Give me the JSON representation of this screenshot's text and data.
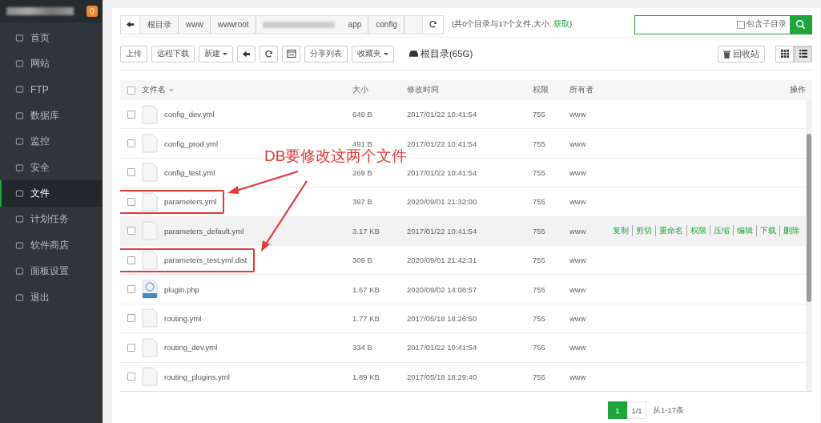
{
  "sidebar": {
    "badge": "0",
    "items": [
      {
        "label": "首页",
        "selected": false
      },
      {
        "label": "网站",
        "selected": false
      },
      {
        "label": "FTP",
        "selected": false
      },
      {
        "label": "数据库",
        "selected": false
      },
      {
        "label": "监控",
        "selected": false
      },
      {
        "label": "安全",
        "selected": false
      },
      {
        "label": "文件",
        "selected": true
      },
      {
        "label": "计划任务",
        "selected": false
      },
      {
        "label": "软件商店",
        "selected": false
      },
      {
        "label": "面板设置",
        "selected": false
      },
      {
        "label": "退出",
        "selected": false
      }
    ]
  },
  "breadcrumb": {
    "segments": [
      "根目录",
      "www",
      "wwwroot",
      "app",
      "config"
    ],
    "summary": "(共0个目录与17个文件,大小:",
    "summary_link": "获取",
    "summary_end": ")"
  },
  "search": {
    "checkbox_label": "包含子目录",
    "checked": false
  },
  "toolbar": {
    "buttons": [
      {
        "label": "上传",
        "kind": "text"
      },
      {
        "label": "远程下载",
        "kind": "text"
      },
      {
        "label": "新建",
        "kind": "dropdown"
      },
      {
        "kind": "back"
      },
      {
        "kind": "refresh"
      },
      {
        "kind": "terminal"
      },
      {
        "label": "分享列表",
        "kind": "text"
      },
      {
        "label": "收藏夹",
        "kind": "dropdown"
      }
    ],
    "disk": "根目录(65G)",
    "recycle": "回收站",
    "view_grid_selected": false,
    "view_list_selected": true
  },
  "table": {
    "select_all_checked": false,
    "columns": [
      "文件名",
      "大小",
      "修改时间",
      "权限",
      "所有者",
      "操作"
    ],
    "rows": [
      {
        "name": "config_dev.yml",
        "kind": "file",
        "size": "649 B",
        "modified": "2017/01/22 10:41:54",
        "perm": "755",
        "owner": "www",
        "highlighted": false,
        "hovered": false,
        "checked": false
      },
      {
        "name": "config_prod.yml",
        "kind": "file",
        "size": "491 B",
        "modified": "2017/01/22 10:41:54",
        "perm": "755",
        "owner": "www",
        "highlighted": false,
        "hovered": false,
        "checked": false
      },
      {
        "name": "config_test.yml",
        "kind": "file",
        "size": "269 B",
        "modified": "2017/01/22 10:41:54",
        "perm": "755",
        "owner": "www",
        "highlighted": false,
        "hovered": false,
        "checked": false
      },
      {
        "name": "parameters.yml",
        "kind": "file",
        "size": "397 B",
        "modified": "2020/09/01 21:32:00",
        "perm": "755",
        "owner": "www",
        "highlighted": true,
        "hovered": false,
        "checked": false
      },
      {
        "name": "parameters_default.yml",
        "kind": "file",
        "size": "3.17 KB",
        "modified": "2017/01/22 10:41:54",
        "perm": "755",
        "owner": "www",
        "highlighted": false,
        "hovered": true,
        "checked": false,
        "actions": [
          "复制",
          "剪切",
          "重命名",
          "权限",
          "压缩",
          "编辑",
          "下载",
          "删除"
        ]
      },
      {
        "name": "parameters_test.yml.dist",
        "kind": "file",
        "size": "309 B",
        "modified": "2020/09/01 21:42:31",
        "perm": "755",
        "owner": "www",
        "highlighted": true,
        "hovered": false,
        "checked": false
      },
      {
        "name": "plugin.php",
        "kind": "php",
        "size": "1.67 KB",
        "modified": "2020/09/02 14:08:57",
        "perm": "755",
        "owner": "www",
        "highlighted": false,
        "hovered": false,
        "checked": false
      },
      {
        "name": "routing.yml",
        "kind": "file",
        "size": "1.77 KB",
        "modified": "2017/05/18 18:26:50",
        "perm": "755",
        "owner": "www",
        "highlighted": false,
        "hovered": false,
        "checked": false
      },
      {
        "name": "routing_dev.yml",
        "kind": "file",
        "size": "334 B",
        "modified": "2017/01/22 10:41:54",
        "perm": "755",
        "owner": "www",
        "highlighted": false,
        "hovered": false,
        "checked": false
      },
      {
        "name": "routing_plugins.yml",
        "kind": "file",
        "size": "1.89 KB",
        "modified": "2017/05/18 18:29:40",
        "perm": "755",
        "owner": "www",
        "highlighted": false,
        "hovered": false,
        "checked": false
      }
    ]
  },
  "pagination": {
    "pages": [
      {
        "label": "1",
        "selected": true
      }
    ],
    "count": "1/1",
    "info": "从1-17条"
  },
  "annotation": {
    "text": "DB要修改这两个文件"
  }
}
